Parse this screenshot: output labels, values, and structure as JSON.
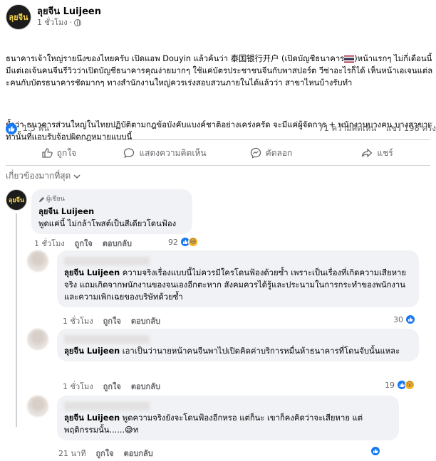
{
  "post": {
    "page_name": "ลุยจีน Luijeen",
    "avatar_text": "ลุยจีน",
    "time": "1 ชั่วโมง",
    "paragraph1_part1": "ธนาคารเจ้าใหญ่รายนึงของไทยครับ เปิดแอพ Douyin แล้วค้นว่า 泰国银行开户 (เปิดบัญชีธนาคาร",
    "paragraph1_part2": ")หน้าแรกๆ ไม่กี่เดือนนี้มีแต่เอเจ้นคนจีนรีวิวว่าเปิดบัญชีธนาคารคุณง่ายมากๆ ใช้แค่บัตรประชาชนจีนกับพาสปอร์ต วีซ่าอะไรก็ได้ เห็นหน้าเอเจนแต่ละคนกับบัตรธนาคารชัดมากๆ ทางสำนักงานใหญ่ควรเร่งสอบสวนภายในได้แล้วว่า สาขาไหนบ้างรับทำ",
    "paragraph2": "ย้ำว่า ธนาคารส่วนใหญ่ในไทยปฏิบัติตามกฎข้อบังคับแบงค์ชาติอย่างเคร่งครัด จะมีแค่ผู้จัดการ + พนักงานบางคน บางสาขาเท่านั้นที่แอบรับจ้อปผิดกฎหมายแบบนี้",
    "reaction_count": "1.5 พัน",
    "comment_count": "71 ความคิดเห็น",
    "share_count": "แชร์ 198 ครั้ง"
  },
  "actions": {
    "like": "ถูกใจ",
    "comment": "แสดงความคิดเห็น",
    "copy": "คัดลอก",
    "share": "แชร์"
  },
  "filter": {
    "label": "เกี่ยวข้องมากที่สุด"
  },
  "comments": [
    {
      "author_tag": "ผู้เขียน",
      "name": "ลุยจีน Luijeen",
      "text": "พูดแค่นี้ ไม่กล้าโพสต์เป็นสีเดียวโดนฟ้อง",
      "time": "1 ชั่วโมง",
      "like": "ถูกใจ",
      "reply": "ตอบกลับ",
      "reactions": "92"
    },
    {
      "mention": "ลุยจีน Luijeen",
      "text": " ความจริงเรื่องแบบนี้ไม่ควรมีใครโดนฟ้องด้วยซ้ำ เพราะเป็นเรื่องที่เกิดความเสียหายจริง แถมเกิดจากพนักงานของจนเองอีกตะหาก สังคมควรได้รู้และประนามในการกระทำของพนักงาน และความเพิกเฉยของบริษัทด้วยซ้ำ",
      "time": "1 ชั่วโมง",
      "like": "ถูกใจ",
      "reply": "ตอบกลับ",
      "reactions": "30"
    },
    {
      "mention": "ลุยจีน Luijeen",
      "text": " เอาเป็นว่านายหน้าคนจีนพาไปเปิดคิดค่าบริการหมื่นห้าธนาคารที่โดนจับนั้นแหละ",
      "time": "1 ชั่วโมง",
      "like": "ถูกใจ",
      "reply": "ตอบกลับ",
      "reactions": "19"
    },
    {
      "mention": "ลุยจีน Luijeen",
      "text": " พูดความจริงยังจะโดนฟ้องอีกหรอ แต่ก็นะ เขาก็คงคิดว่าจะเสียหาย แต่พฤติกรรมนั้น......",
      "text_end": "ท",
      "time": "21 นาที",
      "like": "ถูกใจ",
      "reply": "ตอบกลับ",
      "reactions": ""
    }
  ],
  "colors": {
    "facebook_blue": "#1877f2",
    "bubble": "#f0f2f5",
    "muted": "#65676b"
  }
}
